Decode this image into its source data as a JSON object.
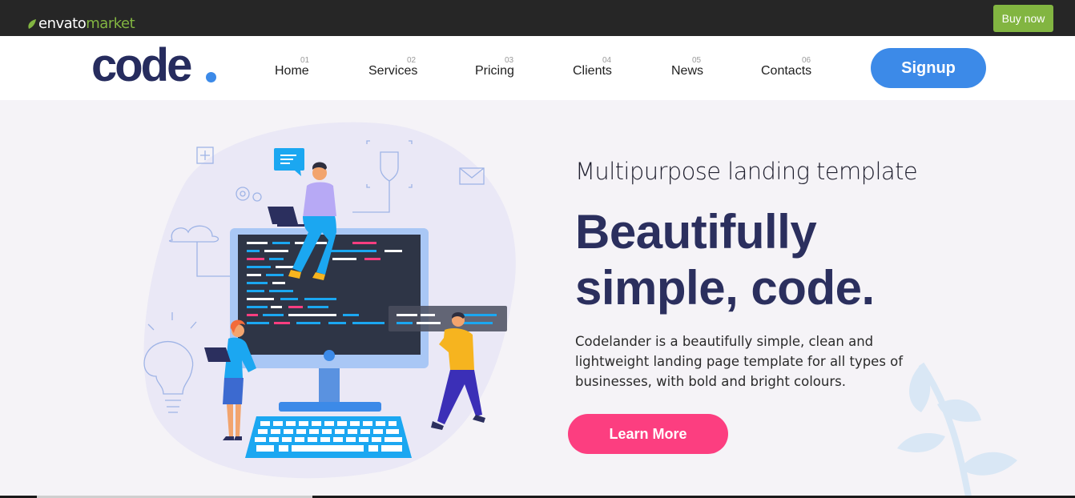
{
  "envato": {
    "logo_left": "envato",
    "logo_right": "market",
    "buy_now": "Buy now"
  },
  "header": {
    "brand": "code",
    "nav": [
      {
        "num": "01",
        "label": "Home"
      },
      {
        "num": "02",
        "label": "Services"
      },
      {
        "num": "03",
        "label": "Pricing"
      },
      {
        "num": "04",
        "label": "Clients"
      },
      {
        "num": "05",
        "label": "News"
      },
      {
        "num": "06",
        "label": "Contacts"
      }
    ],
    "signup": "Signup"
  },
  "hero": {
    "kicker": "Multipurpose landing template",
    "headline": "Beautifully simple, code.",
    "description": "Codelander is a beautifully simple, clean and lightweight landing page template for all types of businesses, with bold and bright colours.",
    "cta": "Learn More",
    "illustration": "developers-at-computer-illustration"
  },
  "colors": {
    "envato_bar": "#262626",
    "envato_green": "#82b541",
    "brand_navy": "#262c5e",
    "accent_blue": "#3c8ae8",
    "cta_pink": "#fc3e80",
    "hero_bg": "#f5f3f7"
  }
}
